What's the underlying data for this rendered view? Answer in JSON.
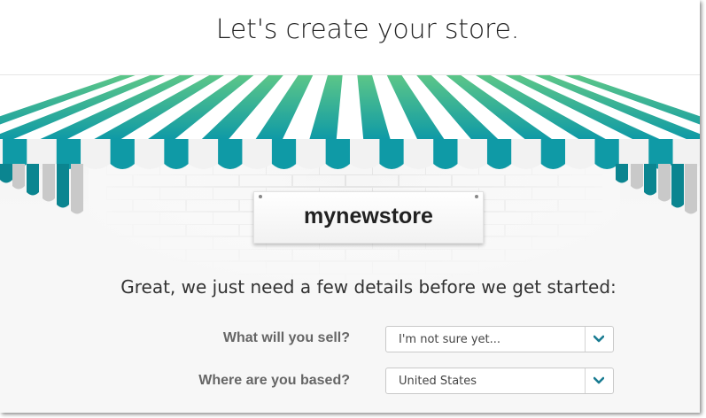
{
  "header": {
    "title": "Let's create your store."
  },
  "sign": {
    "store_name": "mynewstore"
  },
  "intro": {
    "text": "Great, we just need a few details before we get started:"
  },
  "form": {
    "sell": {
      "label": "What will you sell?",
      "value": "I'm not sure yet..."
    },
    "based": {
      "label": "Where are you based?",
      "value": "United States"
    }
  },
  "colors": {
    "teal": "#0f9aa6",
    "green": "#5cc688",
    "chevron": "#1a7c92"
  },
  "icons": {
    "dropdown": "chevron-down-icon"
  }
}
